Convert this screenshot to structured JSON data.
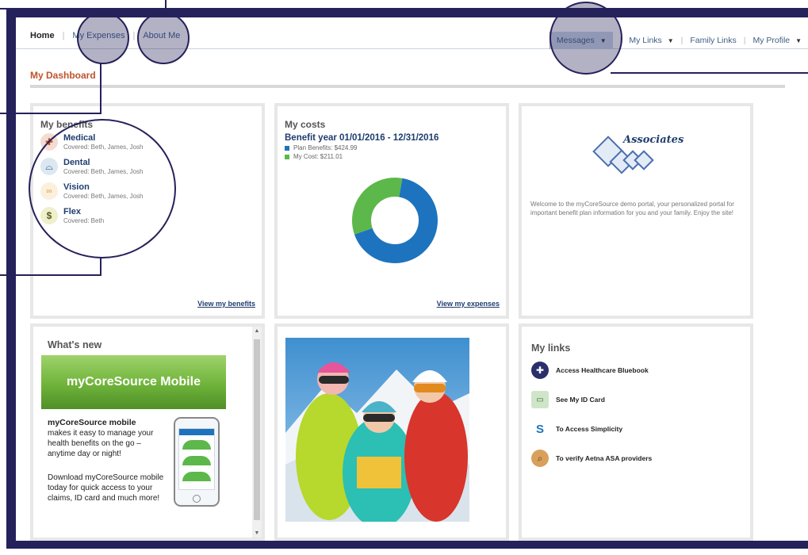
{
  "nav": {
    "home": "Home",
    "my_expenses": "My Expenses",
    "about_me": "About Me",
    "messages": "Messages",
    "my_links": "My Links",
    "family_links": "Family Links",
    "my_profile": "My Profile",
    "caret": "▼"
  },
  "dashboard": {
    "title": "My Dashboard"
  },
  "benefits": {
    "title": "My benefits",
    "items": [
      {
        "name": "Medical",
        "covered": "Covered: Beth, James, Josh",
        "icon": "medical-kit-icon"
      },
      {
        "name": "Dental",
        "covered": "Covered: Beth, James, Josh",
        "icon": "tooth-icon"
      },
      {
        "name": "Vision",
        "covered": "Covered: Beth, James, Josh",
        "icon": "glasses-icon"
      },
      {
        "name": "Flex",
        "covered": "Covered: Beth",
        "icon": "dollar-icon"
      }
    ],
    "view_link": "View my benefits"
  },
  "costs": {
    "title": "My costs",
    "year": "Benefit year 01/01/2016 - 12/31/2016",
    "legend": [
      {
        "label": "Plan Benefits: $424.99",
        "color": "#1e73be"
      },
      {
        "label": "My Cost: $211.01",
        "color": "#5cb84a"
      }
    ],
    "view_link": "View my expenses"
  },
  "chart_data": {
    "type": "pie",
    "categories": [
      "Plan Benefits",
      "My Cost"
    ],
    "values": [
      424.99,
      211.01
    ],
    "colors": [
      "#1e73be",
      "#5cb84a"
    ],
    "donut": true
  },
  "associates": {
    "logo_text": "Associates",
    "welcome": "Welcome to the myCoreSource demo portal, your personalized portal for important benefit plan information for you and your family. Enjoy the site!"
  },
  "whats_new": {
    "title": "What's new",
    "banner": "myCoreSource Mobile",
    "heading": "myCoreSource mobile",
    "text1": "makes it easy to manage your health benefits on the go – anytime day or night!",
    "text2": "Download myCoreSource mobile today for quick access to your claims, ID card and much more!"
  },
  "my_links": {
    "title": "My links",
    "items": [
      {
        "label": "Access Healthcare Bluebook",
        "icon": "healthcare-bluebook-icon",
        "color": "#2a2f6b"
      },
      {
        "label": "See My ID Card",
        "icon": "id-card-icon",
        "color": "#cfe5c8"
      },
      {
        "label": "To Access Simplicity",
        "icon": "simplicity-icon",
        "color": "#1e73be"
      },
      {
        "label": "To verify Aetna ASA providers",
        "icon": "search-provider-icon",
        "color": "#d9a05b"
      }
    ]
  }
}
